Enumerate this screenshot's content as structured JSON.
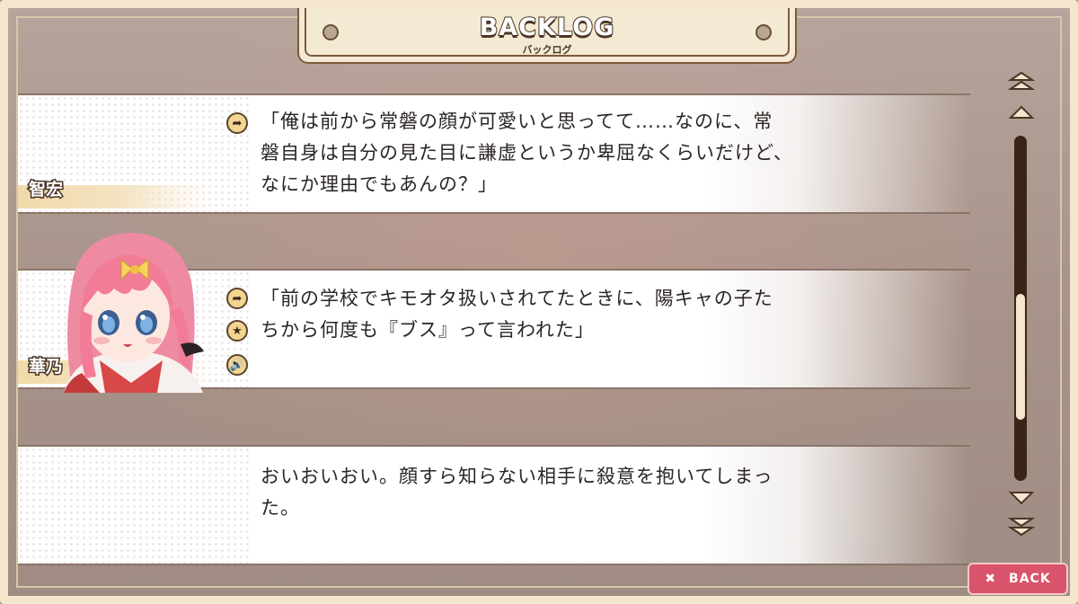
{
  "header": {
    "title": "BACKLOG",
    "subtitle": "バックログ"
  },
  "entries": [
    {
      "speaker": "智宏",
      "text": "「俺は前から常磐の顔が可愛いと思ってて……なのに、常\n磐自身は自分の見た目に謙虚というか卑屈なくらいだけど、\nなにか理由でもあんの？」",
      "controls": [
        "jump-icon"
      ]
    },
    {
      "speaker": "華乃",
      "text": "「前の学校でキモオタ扱いされてたときに、陽キャの子た\nちから何度も『ブス』って言われた」",
      "controls": [
        "jump-icon",
        "star-icon",
        "voice-icon"
      ]
    },
    {
      "speaker": "",
      "text": "おいおいおい。顔すら知らない相手に殺意を抱いてしまっ\nた。",
      "controls": []
    }
  ],
  "scrollbar": {
    "position": 0.72,
    "buttons": [
      "scroll-to-top",
      "scroll-up",
      "scroll-down",
      "scroll-to-bottom"
    ]
  },
  "footer": {
    "back_label": "BACK"
  },
  "colors": {
    "frame": "#f3e6cc",
    "title_outline": "#4a3526",
    "back_button": "#d9546a",
    "control_icon": "#f2d58f"
  }
}
